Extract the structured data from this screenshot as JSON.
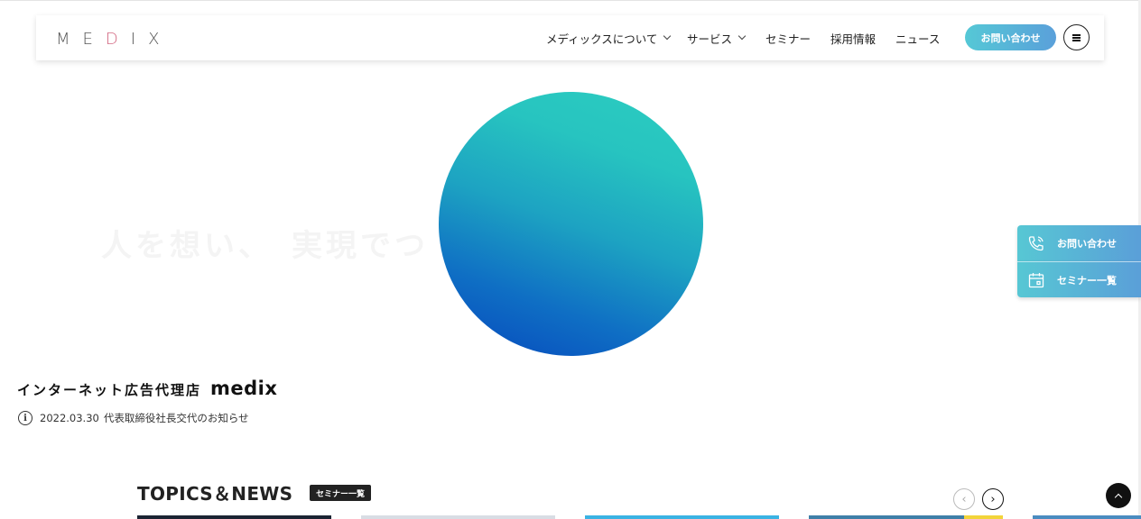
{
  "header": {
    "logo": {
      "letters": [
        "M",
        "E",
        "D",
        "I",
        "X"
      ],
      "accent_color": "#d36a83"
    },
    "nav": [
      {
        "label": "メディックスについて",
        "has_dropdown": true
      },
      {
        "label": "サービス",
        "has_dropdown": true
      },
      {
        "label": "セミナー",
        "has_dropdown": false
      },
      {
        "label": "採用情報",
        "has_dropdown": false
      },
      {
        "label": "ニュース",
        "has_dropdown": false
      }
    ],
    "contact_button": "お問い合わせ",
    "menu_icon": "hamburger-icon"
  },
  "hero": {
    "background_text": "人を想い、　実現でつ",
    "tagline_jp": "インターネット広告代理店",
    "tagline_brand": "medix",
    "notice": {
      "date": "2022.03.30",
      "text": "代表取締役社長交代のお知らせ",
      "icon": "info-icon"
    },
    "circle_gradient": [
      "#2ccdbf",
      "#0647bd"
    ]
  },
  "side_buttons": [
    {
      "label": "お問い合わせ",
      "icon": "phone-icon"
    },
    {
      "label": "セミナー一覧",
      "icon": "calendar-icon"
    }
  ],
  "topics": {
    "title": "TOPICS＆NEWS",
    "tag": "セミナー一覧",
    "prev_icon": "chevron-left-icon",
    "next_icon": "chevron-right-icon"
  },
  "back_to_top_icon": "arrow-up-icon",
  "colors": {
    "accent_gradient_start": "#55c8d6",
    "accent_gradient_end": "#5aa0da",
    "text": "#222222"
  }
}
